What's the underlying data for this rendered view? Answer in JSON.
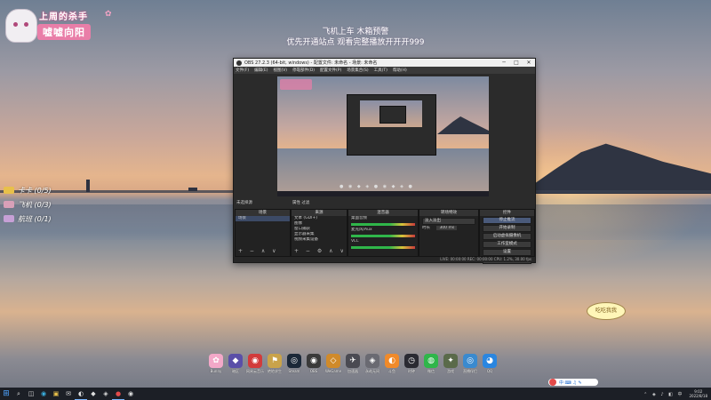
{
  "stream_overlay": {
    "logo_top": "上周的杀手",
    "logo_main": "嘘嘘向阳",
    "logo_flower": "✿",
    "notice_lines": [
      "飞机上车 木箱预警",
      "优先开通站点 观看完整播放开开开999"
    ],
    "side_items": [
      {
        "label": "卡卡 (0/5)",
        "color": "#e8c04a"
      },
      {
        "label": "飞机 (0/3)",
        "color": "#d9a0b8"
      },
      {
        "label": "航班 (0/1)",
        "color": "#c7a0d6"
      }
    ],
    "bubble_text": "吃吃我我"
  },
  "obs_window": {
    "title": "OBS 27.2.3 (64-bit, windows) - 配置文件: 未命名 - 场景: 未命名",
    "menu": [
      "文件(F)",
      "编辑(E)",
      "视图(V)",
      "停靠部件(D)",
      "配置文件(P)",
      "场景集合(S)",
      "工具(T)",
      "帮助(H)"
    ],
    "docks_header": "未选择源",
    "docks_header_right": "属性  过滤",
    "panels": {
      "scenes": {
        "title": "场景",
        "items": [
          "场景"
        ]
      },
      "sources": {
        "title": "来源",
        "items": [
          "文本 (GDI+)",
          "图像",
          "窗口捕获",
          "显示器采集",
          "视频采集设备"
        ]
      },
      "mixer": {
        "title": "混音器",
        "channels": [
          "桌面音频",
          "麦克风/Aux",
          "VLC"
        ]
      },
      "transitions": {
        "title": "转场特效",
        "type": "淡入淡出",
        "duration_label": "时长",
        "duration_value": "300 ms"
      },
      "controls": {
        "title": "控件",
        "buttons": [
          "停止推流",
          "开始录制",
          "启动虚拟摄像机",
          "工作室模式",
          "设置",
          "退出"
        ]
      }
    },
    "status": "LIVE: 00:00:00  REC: 00:00:00  CPU: 1.2%, 30.00 fps"
  },
  "desktop_icons": [
    {
      "label": "Bunny",
      "glyph": "✿",
      "color": "#f3a8c8"
    },
    {
      "label": "暗区",
      "glyph": "◆",
      "color": "#5a4fa8"
    },
    {
      "label": "网易云音乐",
      "glyph": "◉",
      "color": "#d23b3b"
    },
    {
      "label": "绝地求生",
      "glyph": "⚑",
      "color": "#c9a34a"
    },
    {
      "label": "Steam",
      "glyph": "◎",
      "color": "#1b2838"
    },
    {
      "label": "OBS",
      "glyph": "◉",
      "color": "#3a3a3a"
    },
    {
      "label": "WeGame",
      "glyph": "◇",
      "color": "#d08a2a"
    },
    {
      "label": "加速器",
      "glyph": "✈",
      "color": "#4a4a52"
    },
    {
      "label": "永劫无间",
      "glyph": "◈",
      "color": "#6a6a72"
    },
    {
      "label": "斗鱼",
      "glyph": "◐",
      "color": "#f08a2a"
    },
    {
      "label": "时钟",
      "glyph": "◷",
      "color": "#2a2a32"
    },
    {
      "label": "微信",
      "glyph": "◍",
      "color": "#2fb64a"
    },
    {
      "label": "游戏",
      "glyph": "✦",
      "color": "#5a6a4a"
    },
    {
      "label": "直播伴侣",
      "glyph": "◎",
      "color": "#3a8acf"
    },
    {
      "label": "QQ",
      "glyph": "◕",
      "color": "#2a86e0"
    }
  ],
  "taskbar": {
    "start_glyph": "⊞",
    "apps": [
      "⌕",
      "◫",
      "◉",
      "▣",
      "✉",
      "◐",
      "◆",
      "◈",
      "●",
      "◉"
    ],
    "ime_text": "中 ⌨ ♫ ✎",
    "time": "9:02",
    "date": "2022/8/18"
  }
}
